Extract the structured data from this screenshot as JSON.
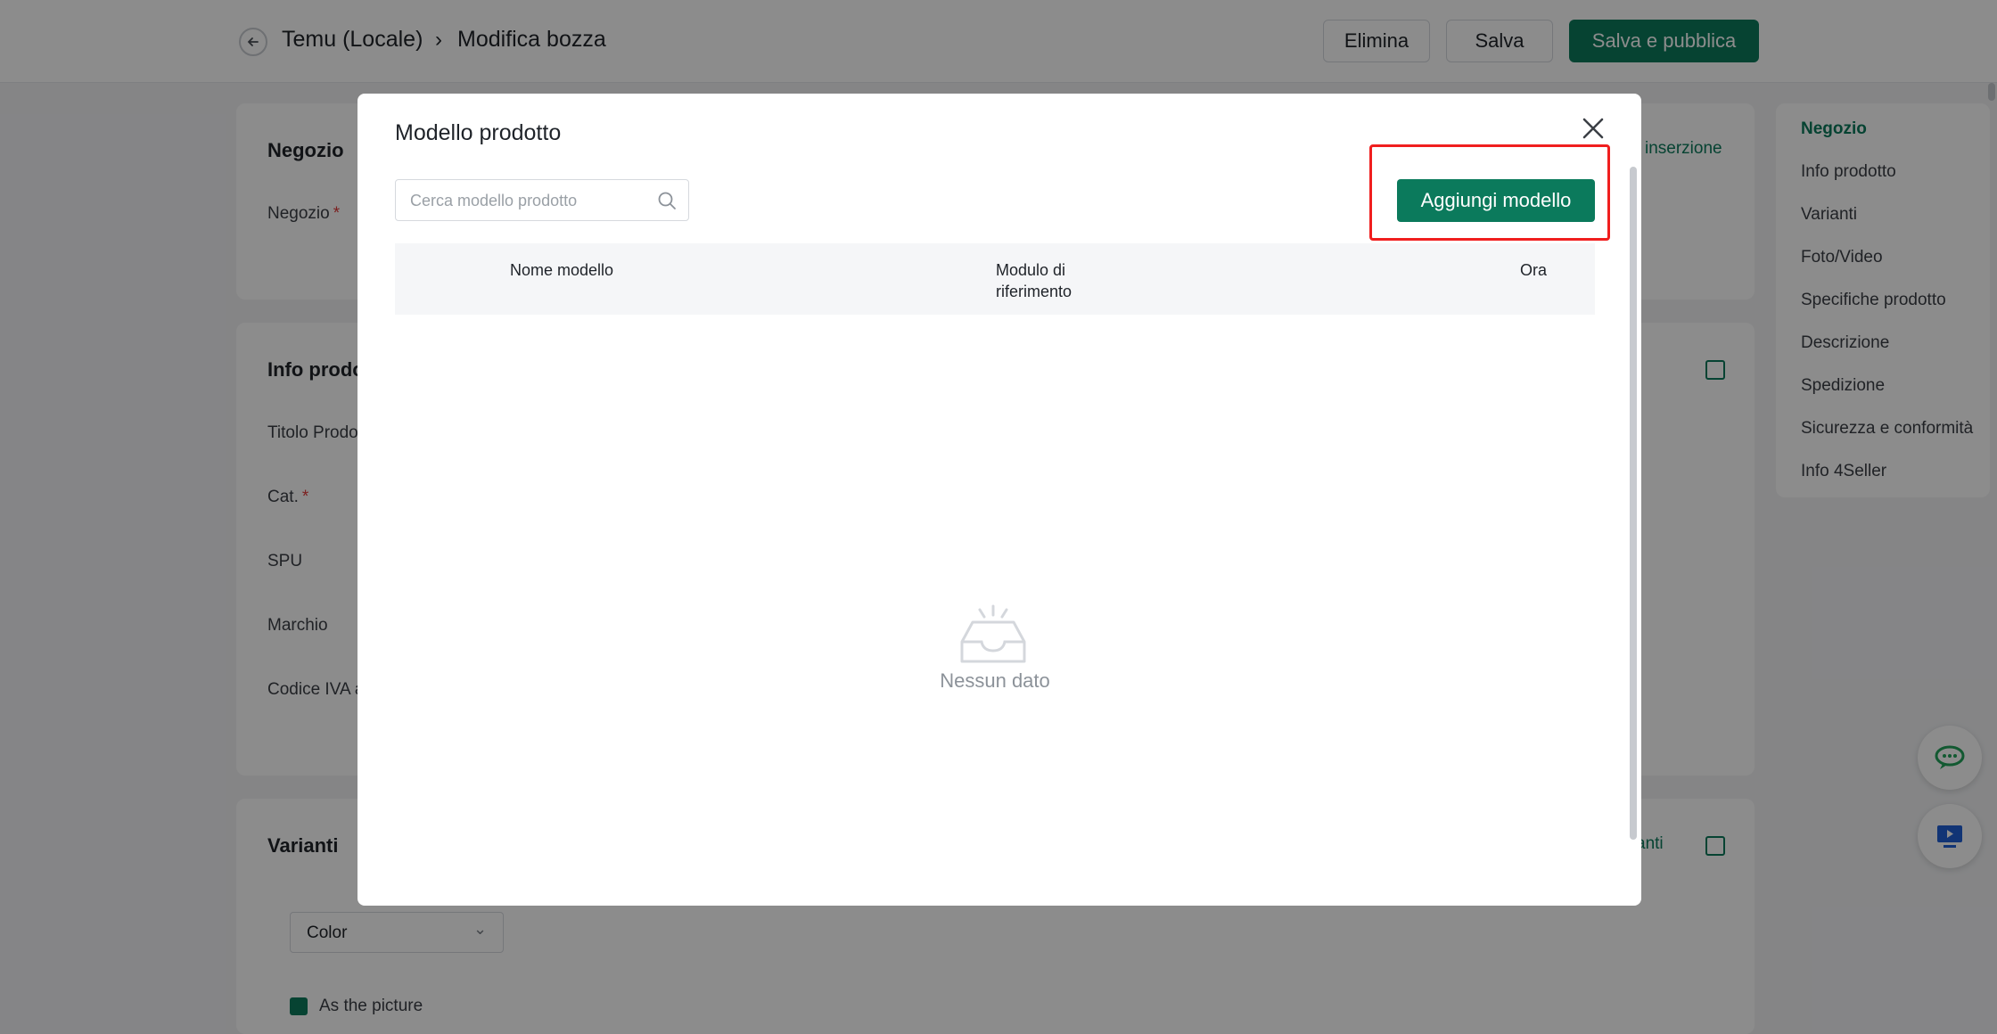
{
  "header": {
    "breadcrumb_root": "Temu (Locale)",
    "breadcrumb_current": "Modifica bozza",
    "delete_label": "Elimina",
    "save_label": "Salva",
    "save_publish_label": "Salva e pubblica"
  },
  "sections": {
    "store": {
      "title": "Negozio",
      "field_store": "Negozio",
      "link": "inserzione"
    },
    "product_info": {
      "title": "Info prodo",
      "fields": [
        "Titolo Prodo",
        "Cat.",
        "SPU",
        "Marchio",
        "Codice IVA a"
      ]
    },
    "variants": {
      "title": "Varianti",
      "link": "anti",
      "select_value": "Color",
      "checkbox_label": "As the picture"
    }
  },
  "right_nav": {
    "items": [
      "Negozio",
      "Info prodotto",
      "Varianti",
      "Foto/Video",
      "Specifiche prodotto",
      "Descrizione",
      "Spedizione",
      "Sicurezza e conformità",
      "Info 4Seller"
    ],
    "active_index": 0
  },
  "modal": {
    "title": "Modello prodotto",
    "search_placeholder": "Cerca modello prodotto",
    "add_button": "Aggiungi modello",
    "columns": [
      "Nome modello",
      "Modulo di riferimento",
      "Ora"
    ],
    "empty_text": "Nessun dato"
  },
  "colors": {
    "primary": "#0b7a5c",
    "highlight": "#f01e1e"
  }
}
